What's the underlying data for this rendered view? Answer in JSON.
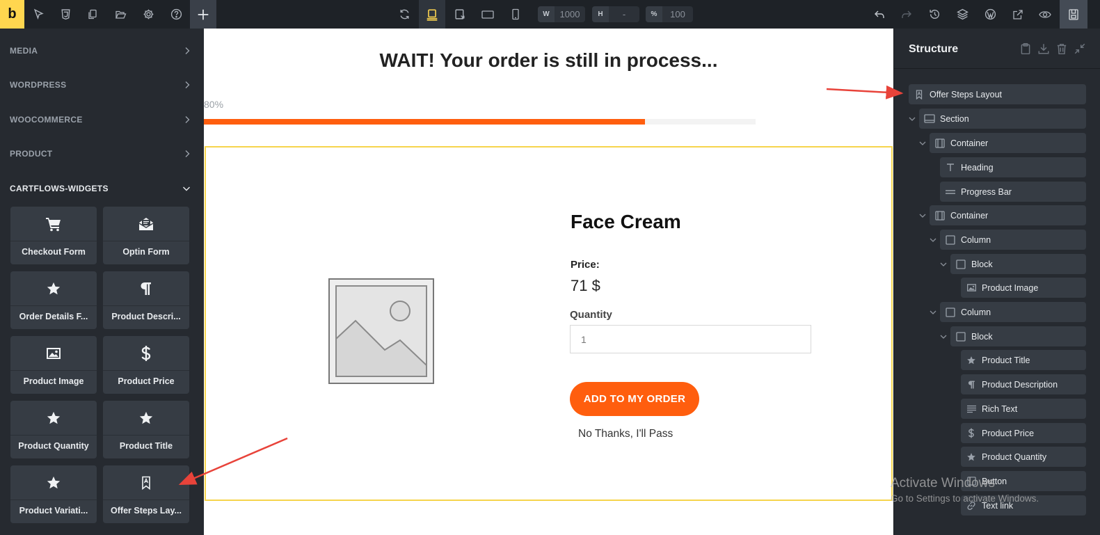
{
  "topbar": {
    "logo": "b",
    "width_label": "W",
    "width_value": "1000",
    "height_label": "H",
    "height_value": "-",
    "zoom_label": "%",
    "zoom_value": "100"
  },
  "left_panel": {
    "categories": [
      {
        "label": "MEDIA"
      },
      {
        "label": "WORDPRESS"
      },
      {
        "label": "WOOCOMMERCE"
      },
      {
        "label": "PRODUCT"
      },
      {
        "label": "CARTFLOWS-WIDGETS"
      }
    ],
    "widgets": [
      {
        "label": "Checkout Form",
        "icon": "cart-icon"
      },
      {
        "label": "Optin Form",
        "icon": "envelope-open-icon"
      },
      {
        "label": "Order Details F...",
        "icon": "star-icon"
      },
      {
        "label": "Product Descri...",
        "icon": "paragraph-icon"
      },
      {
        "label": "Product Image",
        "icon": "image-icon"
      },
      {
        "label": "Product Price",
        "icon": "dollar-icon"
      },
      {
        "label": "Product Quantity",
        "icon": "star-icon"
      },
      {
        "label": "Product Title",
        "icon": "star-icon"
      },
      {
        "label": "Product Variati...",
        "icon": "star-icon"
      },
      {
        "label": "Offer Steps Lay...",
        "icon": "bookmark-icon"
      }
    ]
  },
  "canvas": {
    "heading": "WAIT! Your order is still in process...",
    "progress_label": "80%",
    "progress": 0.8,
    "product": {
      "title": "Face Cream",
      "price_label": "Price:",
      "price": "71 $",
      "quantity_label": "Quantity",
      "quantity_value": "1",
      "button_label": "ADD TO MY ORDER",
      "decline_label": "No Thanks, I'll Pass"
    }
  },
  "structure": {
    "title": "Structure",
    "nodes": [
      {
        "label": "Offer Steps Layout",
        "icon": "bookmark-icon"
      },
      {
        "label": "Section",
        "icon": "section-icon"
      },
      {
        "label": "Container",
        "icon": "container-icon"
      },
      {
        "label": "Heading",
        "icon": "heading-icon"
      },
      {
        "label": "Progress Bar",
        "icon": "bar-icon"
      },
      {
        "label": "Container",
        "icon": "container-icon"
      },
      {
        "label": "Column",
        "icon": "square-icon"
      },
      {
        "label": "Block",
        "icon": "square-icon"
      },
      {
        "label": "Product Image",
        "icon": "image-icon"
      },
      {
        "label": "Column",
        "icon": "square-icon"
      },
      {
        "label": "Block",
        "icon": "square-icon"
      },
      {
        "label": "Product Title",
        "icon": "star-icon"
      },
      {
        "label": "Product Description",
        "icon": "paragraph-icon"
      },
      {
        "label": "Rich Text",
        "icon": "lines-icon"
      },
      {
        "label": "Product Price",
        "icon": "dollar-icon"
      },
      {
        "label": "Product Quantity",
        "icon": "star-icon"
      },
      {
        "label": "Button",
        "icon": "square-icon"
      },
      {
        "label": "Text link",
        "icon": "link-icon"
      }
    ]
  },
  "watermark": {
    "line1": "Activate Windows",
    "line2": "Go to Settings to activate Windows."
  },
  "colors": {
    "accent": "#ffd64f",
    "brand_orange": "#ff5e0e",
    "annotation_red": "#e8433a",
    "selection_outline": "#f6d44c"
  }
}
